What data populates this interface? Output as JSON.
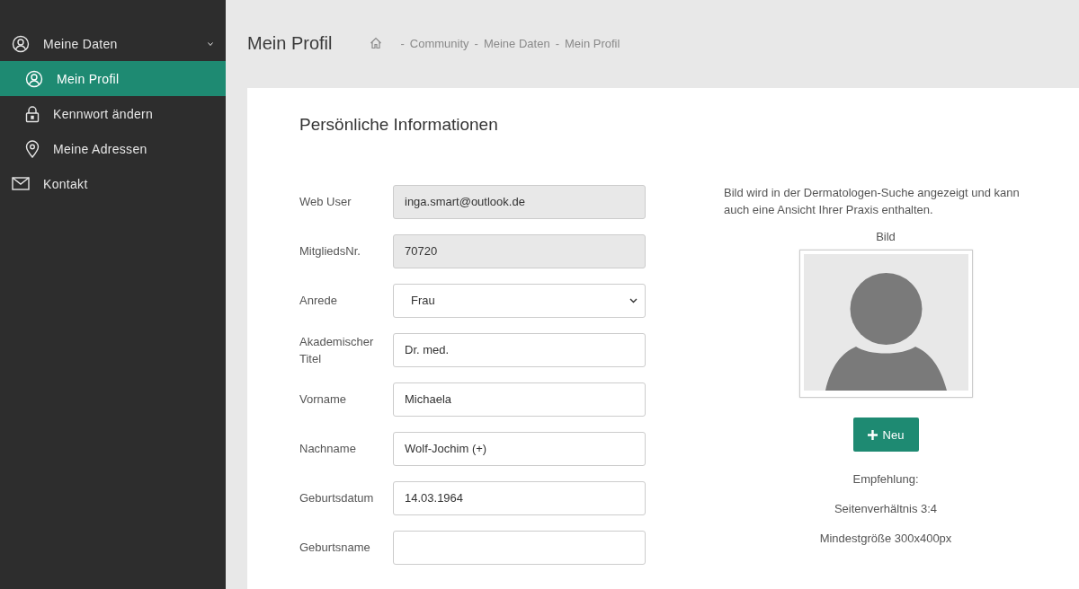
{
  "sidebar": {
    "items": [
      {
        "label": "Meine Daten",
        "expanded": true,
        "selected": false,
        "children": [
          {
            "label": "Mein Profil",
            "selected": true
          },
          {
            "label": "Kennwort ändern",
            "selected": false
          },
          {
            "label": "Meine Adressen",
            "selected": false
          }
        ]
      },
      {
        "label": "Kontakt",
        "selected": false
      }
    ]
  },
  "header": {
    "title": "Mein Profil",
    "breadcrumb": [
      "Community",
      "Meine Daten",
      "Mein Profil"
    ],
    "separator": "-"
  },
  "card": {
    "title": "Persönliche Informationen",
    "fields": [
      {
        "label": "Web User",
        "kind": "text",
        "value": "inga.smart@outlook.de",
        "disabled": true
      },
      {
        "label": "MitgliedsNr.",
        "kind": "text",
        "value": "70720",
        "disabled": true
      },
      {
        "label": "Anrede",
        "kind": "select",
        "value": "Frau",
        "disabled": false
      },
      {
        "label": "Akademischer Titel",
        "kind": "text",
        "value": "Dr. med.",
        "disabled": false
      },
      {
        "label": "Vorname",
        "kind": "text",
        "value": "Michaela",
        "disabled": false
      },
      {
        "label": "Nachname",
        "kind": "text",
        "value": "Wolf-Jochim (+)",
        "disabled": false
      },
      {
        "label": "Geburtsdatum",
        "kind": "text",
        "value": "14.03.1964",
        "disabled": false
      },
      {
        "label": "Geburtsname",
        "kind": "text",
        "disabled": false
      }
    ],
    "image": {
      "description": "Bild wird in der Dermatologen-Suche angezeigt und kann auch eine Ansicht Ihrer Praxis enthalten.",
      "label": "Bild",
      "button": "Neu",
      "notes": [
        "Empfehlung:",
        "Seitenverhältnis 3:4",
        "Mindestgröße 300x400px"
      ]
    }
  }
}
